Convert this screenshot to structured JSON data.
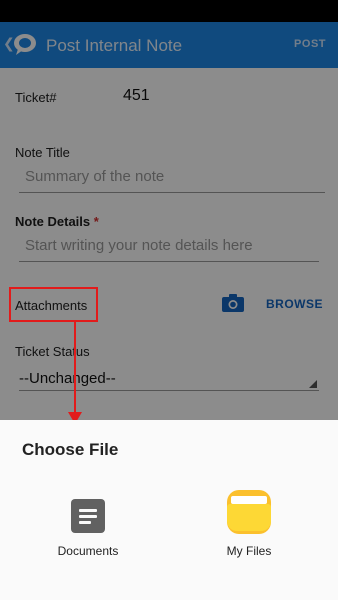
{
  "app_bar": {
    "title": "Post Internal Note",
    "post_label": "POST",
    "color": "#1e88e5"
  },
  "form": {
    "ticket_label": "Ticket#",
    "ticket_value": "451",
    "note_title_label": "Note Title",
    "note_title_placeholder": "Summary of the note",
    "note_details_label": "Note Details",
    "required_mark": "*",
    "note_details_placeholder": "Start writing your note details here",
    "attachments_label": "Attachments",
    "browse_label": "BROWSE",
    "ticket_status_label": "Ticket Status",
    "ticket_status_value": "--Unchanged--"
  },
  "bottom_sheet": {
    "title": "Choose File",
    "options": [
      {
        "label": "Documents",
        "icon": "documents-icon"
      },
      {
        "label": "My Files",
        "icon": "folder-icon"
      }
    ]
  },
  "annotation": {
    "color": "#e21b1b"
  },
  "icons": [
    "back-chevron-icon",
    "app-logo-icon",
    "camera-icon",
    "documents-icon",
    "folder-icon"
  ]
}
